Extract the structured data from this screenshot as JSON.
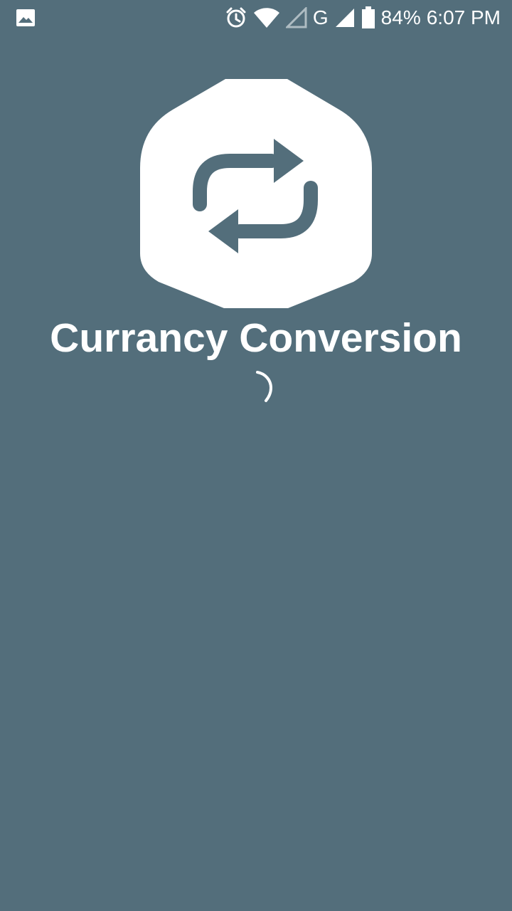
{
  "status_bar": {
    "battery_percent": "84%",
    "time": "6:07 PM",
    "network_type": "G",
    "icons": [
      "image-notification-icon",
      "alarm-icon",
      "wifi-icon",
      "signal-empty-icon",
      "signal-icon",
      "battery-icon"
    ]
  },
  "splash": {
    "title": "Currancy Conversion",
    "logo_icon": "exchange-arrows-icon",
    "loading_indicator": "spinner-icon"
  },
  "colors": {
    "background": "#536e7b",
    "foreground": "#ffffff"
  }
}
